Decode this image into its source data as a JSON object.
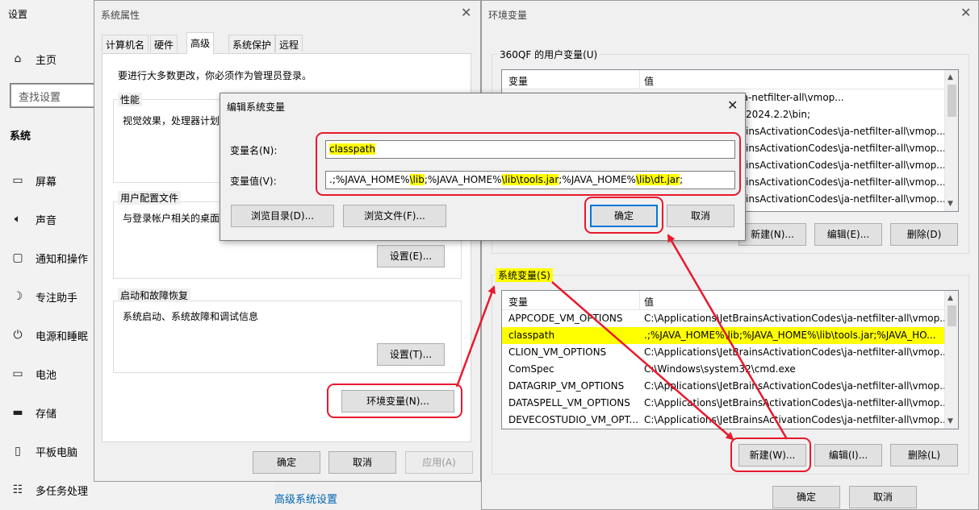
{
  "settings": {
    "title": "设置",
    "home": "主页",
    "search_placeholder": "查找设置",
    "section": "系统",
    "nav": [
      "屏幕",
      "声音",
      "通知和操作",
      "专注助手",
      "电源和睡眠",
      "电池",
      "存储",
      "平板电脑",
      "多任务处理"
    ],
    "advanced_link": "高级系统设置"
  },
  "sysprop": {
    "title": "系统属性",
    "tabs": [
      "计算机名",
      "硬件",
      "高级",
      "系统保护",
      "远程"
    ],
    "admin_note": "要进行大多数更改，你必须作为管理员登录。",
    "perf_label": "性能",
    "perf_desc": "视觉效果，处理器计划",
    "profile_label": "用户配置文件",
    "profile_desc": "与登录帐户相关的桌面",
    "profile_btn": "设置(E)...",
    "startup_label": "启动和故障恢复",
    "startup_desc": "系统启动、系统故障和调试信息",
    "startup_btn": "设置(T)...",
    "env_btn": "环境变量(N)...",
    "ok": "确定",
    "cancel": "取消",
    "apply": "应用(A)"
  },
  "envvars": {
    "title": "环境变量",
    "user_label": "360QF 的用户变量(U)",
    "col_var": "变量",
    "col_val": "值",
    "user_rows": [
      {
        "name": "",
        "value": "insActivationCodes\\ja-netfilter-all\\vmop..."
      },
      {
        "name": "",
        "value": "2024.2.2\\bin;"
      },
      {
        "name": "",
        "value": "insActivationCodes\\ja-netfilter-all\\vmop..."
      },
      {
        "name": "",
        "value": "insActivationCodes\\ja-netfilter-all\\vmop..."
      },
      {
        "name": "",
        "value": "insActivationCodes\\ja-netfilter-all\\vmop..."
      },
      {
        "name": "",
        "value": "insActivationCodes\\ja-netfilter-all\\vmop..."
      },
      {
        "name": "",
        "value": "insActivationCodes\\ja-netfilter-all\\vmop..."
      }
    ],
    "user_new": "新建(N)...",
    "user_edit": "编辑(E)...",
    "user_delete": "删除(D)",
    "sys_label": "系统变量(S)",
    "sys_rows": [
      {
        "name": "APPCODE_VM_OPTIONS",
        "value": "C:\\Applications\\JetBrainsActivationCodes\\ja-netfilter-all\\vmop..."
      },
      {
        "name": "classpath",
        "value": ".;%JAVA_HOME%\\lib;%JAVA_HOME%\\lib\\tools.jar;%JAVA_HO..."
      },
      {
        "name": "CLION_VM_OPTIONS",
        "value": "C:\\Applications\\JetBrainsActivationCodes\\ja-netfilter-all\\vmop..."
      },
      {
        "name": "ComSpec",
        "value": "C:\\Windows\\system32\\cmd.exe"
      },
      {
        "name": "DATAGRIP_VM_OPTIONS",
        "value": "C:\\Applications\\JetBrainsActivationCodes\\ja-netfilter-all\\vmop..."
      },
      {
        "name": "DATASPELL_VM_OPTIONS",
        "value": "C:\\Applications\\JetBrainsActivationCodes\\ja-netfilter-all\\vmop..."
      },
      {
        "name": "DEVECOSTUDIO_VM_OPT...",
        "value": "C:\\Applications\\JetBrainsActivationCodes\\ja-netfilter-all\\vmop..."
      }
    ],
    "sys_new": "新建(W)...",
    "sys_edit": "编辑(I)...",
    "sys_delete": "删除(L)",
    "ok": "确定",
    "cancel": "取消"
  },
  "editdlg": {
    "title": "编辑系统变量",
    "name_label": "变量名(N):",
    "name_value": "classpath",
    "value_label": "变量值(V):",
    "value_parts": [
      ".;%JAVA_HOME%",
      "\\lib",
      ";%JAVA_HOME%",
      "\\lib\\tools.jar",
      ";%JAVA_HOME%",
      "\\lib\\dt.jar",
      ";"
    ],
    "browse_dir": "浏览目录(D)...",
    "browse_file": "浏览文件(F)...",
    "ok": "确定",
    "cancel": "取消"
  },
  "colors": {
    "highlight": "#ffff00",
    "annotation_red": "#e8192c",
    "link_blue": "#0063b1"
  }
}
